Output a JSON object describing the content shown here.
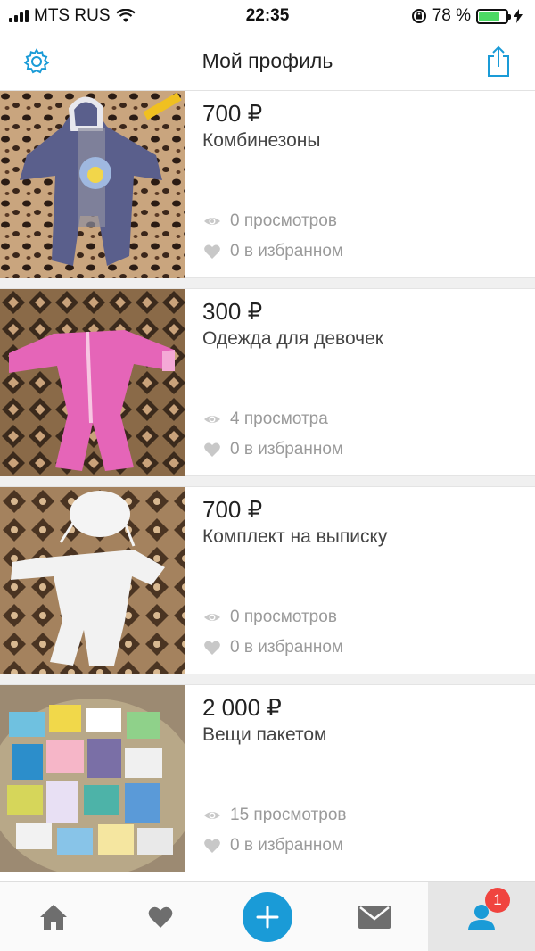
{
  "status_bar": {
    "carrier": "MTS RUS",
    "time": "22:35",
    "battery_percent": "78 %",
    "battery_level": 0.78
  },
  "nav": {
    "title": "Мой профиль",
    "settings_icon": "gear-icon",
    "share_icon": "share-icon"
  },
  "listings": [
    {
      "price": "700 ₽",
      "title": "Комбинезоны",
      "views": "0 просмотров",
      "favorites": "0 в избранном"
    },
    {
      "price": "300 ₽",
      "title": "Одежда для девочек",
      "views": "4 просмотра",
      "favorites": "0 в избранном"
    },
    {
      "price": "700 ₽",
      "title": "Комплект на выписку",
      "views": "0 просмотров",
      "favorites": "0 в избранном"
    },
    {
      "price": "2 000 ₽",
      "title": "Вещи пакетом",
      "views": "15 просмотров",
      "favorites": "0 в избранном"
    }
  ],
  "tab_bar": {
    "tabs": [
      "home-icon",
      "heart-icon",
      "add-icon",
      "mail-icon",
      "profile-icon"
    ],
    "active": "profile",
    "profile_badge": "1"
  },
  "colors": {
    "accent": "#1a9bd7",
    "badge": "#f0443f",
    "stat_text": "#9a9a9a"
  }
}
